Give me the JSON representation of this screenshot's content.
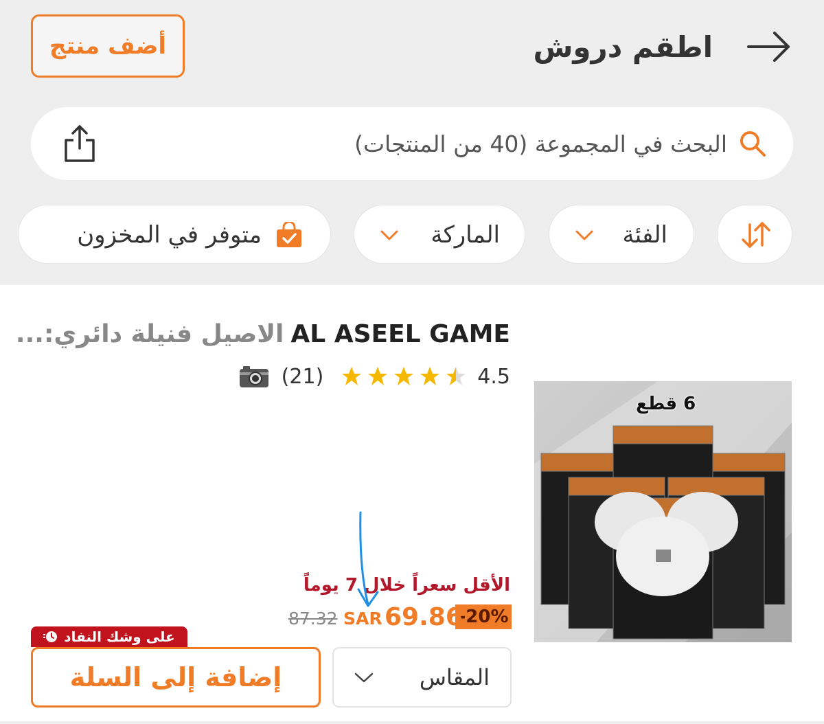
{
  "header": {
    "title": "اطقم دروش",
    "add_product_label": "أضف منتج"
  },
  "search": {
    "placeholder": "البحث في المجموعة (40 من المنتجات)"
  },
  "filters": {
    "category_label": "الفئة",
    "brand_label": "الماركة",
    "in_stock_label": "متوفر في المخزون"
  },
  "product": {
    "title_latin": "AL ASEEL GAME",
    "title_arabic": "الاصيل فنيلة دائري:...",
    "rating": "4.5",
    "rating_value": 4.5,
    "review_count": "(21)",
    "image_label": "6 قطع",
    "lowest_price_note": "الأقل سعراً خلال 7 يوماً",
    "discount": "-20%",
    "sale_price": "69.86",
    "currency": "SAR",
    "old_price": "87.32",
    "low_stock_label": "على وشك النفاد",
    "size_label": "المقاس",
    "add_to_cart_label": "إضافة إلى السلة"
  },
  "colors": {
    "accent": "#f07c27",
    "alert_red": "#c0131e",
    "price_note_red": "#b3182a",
    "star_yellow": "#f5b800",
    "annotation_blue": "#1f8fe6"
  },
  "icons": [
    "back-arrow-icon",
    "search-icon",
    "share-icon",
    "sort-icon",
    "chevron-down-icon",
    "shopping-bag-check-icon",
    "star-icon",
    "camera-icon",
    "clock-icon"
  ]
}
